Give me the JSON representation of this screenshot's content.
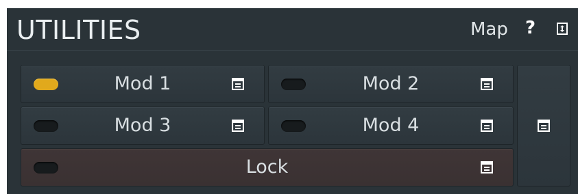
{
  "header": {
    "title": "UTILITIES",
    "map_label": "Map",
    "help_label": "?",
    "collapse_icon": "collapse-icon"
  },
  "buttons": [
    {
      "label": "Mod 1",
      "active": true
    },
    {
      "label": "Mod 2",
      "active": false
    },
    {
      "label": "Mod 3",
      "active": false
    },
    {
      "label": "Mod 4",
      "active": false
    }
  ],
  "lock": {
    "label": "Lock",
    "active": false
  },
  "side_menu_icon": "menu-icon",
  "colors": {
    "panel_bg": "#2a3338",
    "button_bg": "#2f393f",
    "lock_bg": "#3c3334",
    "led_on": "#e1a91c",
    "led_off": "#171b1d",
    "text": "#d9dfe2"
  }
}
